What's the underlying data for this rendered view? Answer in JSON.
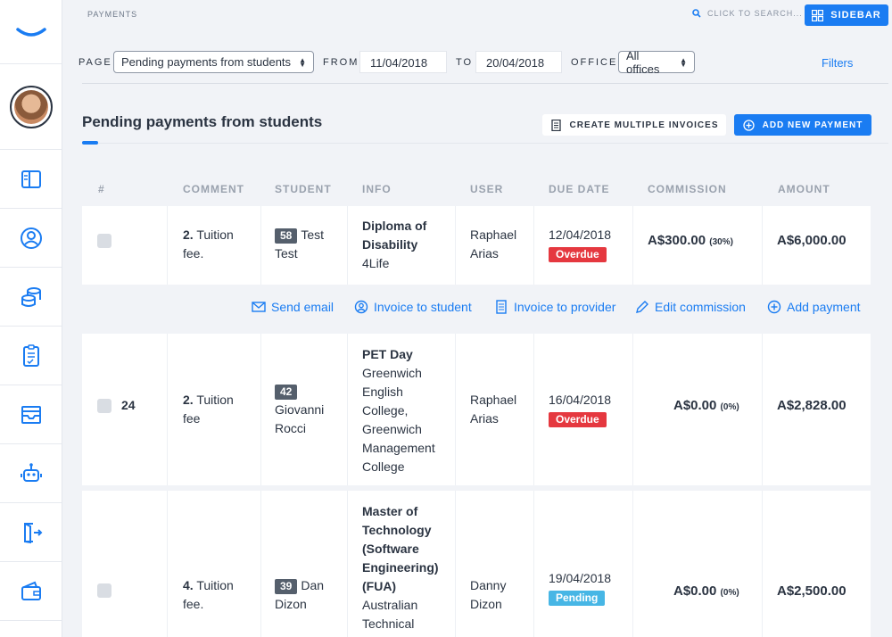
{
  "header": {
    "breadcrumb": "PAYMENTS",
    "search_label": "CLICK TO SEARCH...",
    "sidebar_button": "SIDEBAR"
  },
  "filters": {
    "page_label": "PAGE",
    "page_value": "Pending payments from students",
    "from_label": "FROM",
    "from_value": "11/04/2018",
    "to_label": "TO",
    "to_value": "20/04/2018",
    "office_label": "OFFICE",
    "office_value": "All offices",
    "filters_link": "Filters"
  },
  "section": {
    "title": "Pending payments from students",
    "create_multiple": "CREATE MULTIPLE INVOICES",
    "add_new": "ADD NEW PAYMENT"
  },
  "table": {
    "columns": [
      "#",
      "COMMENT",
      "STUDENT",
      "INFO",
      "USER",
      "DUE DATE",
      "COMMISSION",
      "AMOUNT"
    ],
    "rows": [
      {
        "num": "",
        "comment_num": "2.",
        "comment_lines": [
          "Tuition",
          "fee."
        ],
        "student_id": "58",
        "student_lines": [
          "Test",
          "Test"
        ],
        "info_bold": [
          "Diploma of",
          "Disability"
        ],
        "info_lines": [
          "4Life"
        ],
        "user_lines": [
          "Raphael",
          "Arias"
        ],
        "due_date": "12/04/2018",
        "status": "Overdue",
        "commission": "A$300.00",
        "commission_pct": "(30%)",
        "amount": "A$6,000.00"
      },
      {
        "num": "24",
        "comment_num": "2.",
        "comment_lines": [
          "Tuition",
          "fee"
        ],
        "student_id": "42",
        "student_lines": [
          "Giovanni",
          "Rocci"
        ],
        "info_bold": [
          "PET Day"
        ],
        "info_lines": [
          "Greenwich",
          "English",
          "College,",
          "Greenwich",
          "Management",
          "College"
        ],
        "user_lines": [
          "Raphael",
          "Arias"
        ],
        "due_date": "16/04/2018",
        "status": "Overdue",
        "commission": "A$0.00",
        "commission_pct": "(0%)",
        "amount": "A$2,828.00"
      },
      {
        "num": "",
        "comment_num": "4.",
        "comment_lines": [
          "Tuition",
          "fee."
        ],
        "student_id": "39",
        "student_lines": [
          "Dan",
          "Dizon"
        ],
        "info_bold": [
          "Master of",
          "Technology",
          "(Software",
          "Engineering)",
          "(FUA)"
        ],
        "info_lines": [
          "Australian",
          "Technical"
        ],
        "user_lines": [
          "Danny",
          "Dizon"
        ],
        "due_date": "19/04/2018",
        "status": "Pending",
        "commission": "A$0.00",
        "commission_pct": "(0%)",
        "amount": "A$2,500.00"
      }
    ]
  },
  "row_actions": [
    "Send email",
    "Invoice to student",
    "Invoice to provider",
    "Edit commission",
    "Add payment"
  ],
  "colors": {
    "accent": "#1a7cf2",
    "overdue": "#e5383f",
    "pending": "#47b6e5"
  },
  "rail_icons": [
    "brand-logo-icon",
    "avatar",
    "dashboard-icon",
    "user-icon",
    "coins-icon",
    "checklist-icon",
    "inbox-icon",
    "robot-icon",
    "logout-icon",
    "wallet-icon"
  ]
}
